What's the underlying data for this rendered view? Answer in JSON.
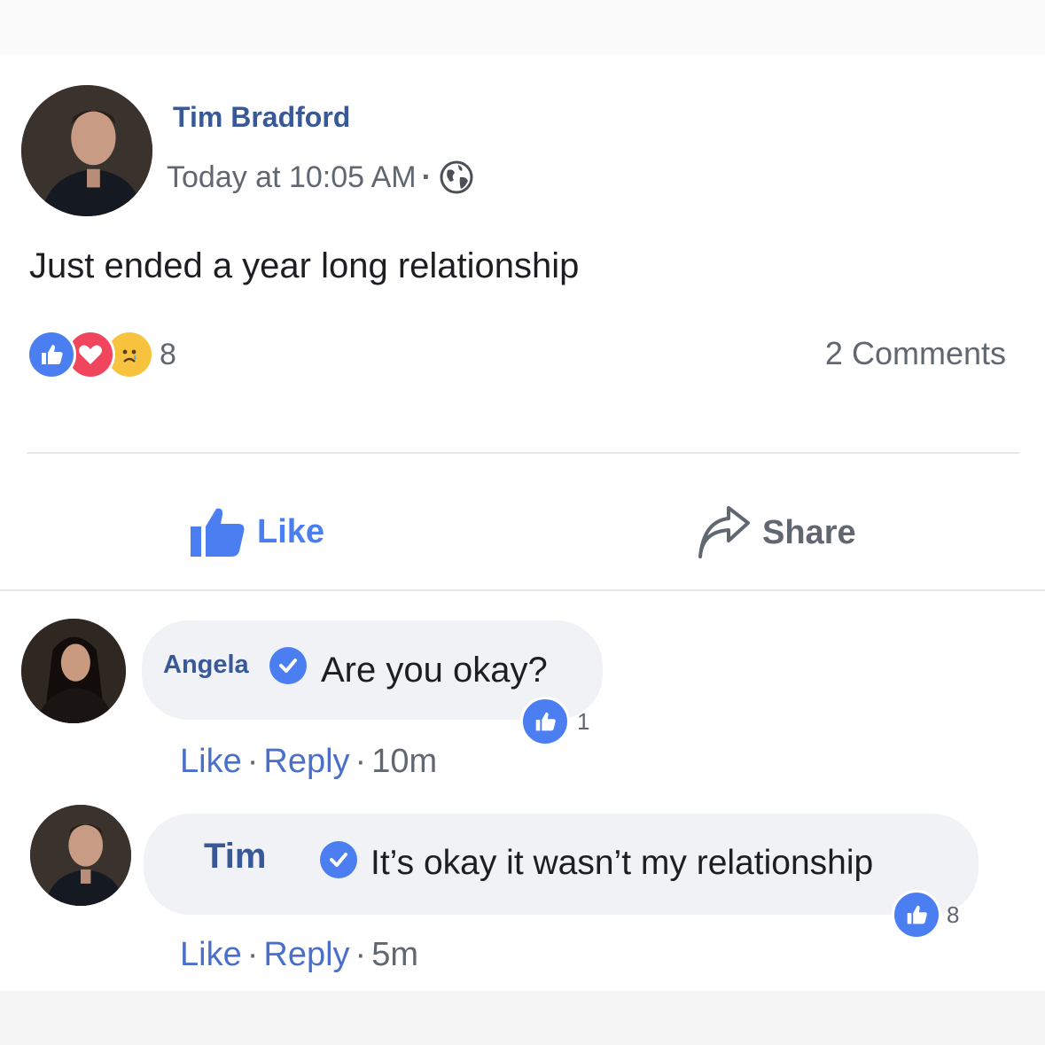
{
  "post": {
    "author": "Tim Bradford",
    "timestamp": "Today at 10:05 AM",
    "privacy_icon": "globe-icon",
    "text": "Just ended a year long relationship",
    "reaction_icons": [
      "like-reaction-icon",
      "love-reaction-icon",
      "sad-reaction-icon"
    ],
    "reaction_count": "8",
    "comments_label": "2 Comments"
  },
  "actions": {
    "like_label": "Like",
    "share_label": "Share"
  },
  "comments": [
    {
      "author": "Angela",
      "text": "Are you okay?",
      "likes": "1",
      "like_link": "Like",
      "reply_link": "Reply",
      "age": "10m"
    },
    {
      "author": "Tim",
      "text": "It’s okay it wasn’t my relationship",
      "likes": "8",
      "like_link": "Like",
      "reply_link": "Reply",
      "age": "5m"
    }
  ],
  "colors": {
    "name_blue": "#385898",
    "like_blue": "#4a7ef1",
    "meta_gray": "#606770",
    "bubble_bg": "#f0f2f5"
  }
}
